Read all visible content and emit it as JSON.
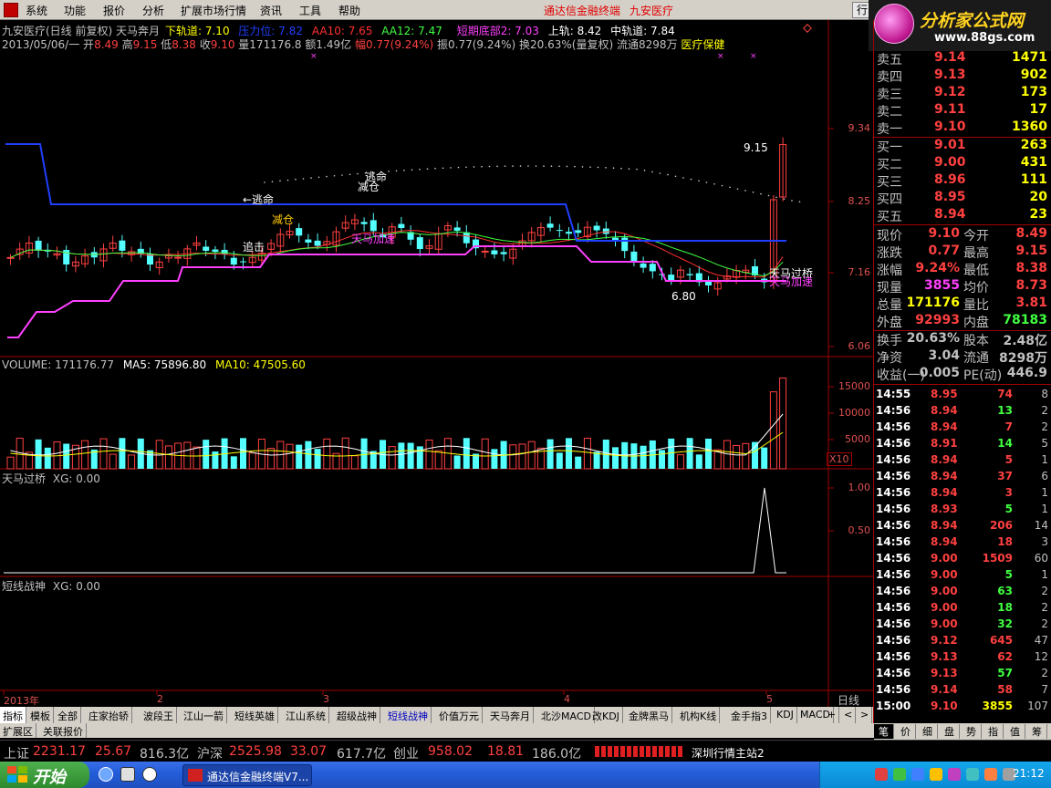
{
  "menu": [
    "系统",
    "功能",
    "报价",
    "分析",
    "扩展市场行情",
    "资讯",
    "工具",
    "帮助"
  ],
  "menu_title": [
    "通达信金融终端",
    "九安医疗"
  ],
  "hq_button": "行",
  "logo": {
    "main": "分析家公式网",
    "url": "www.88gs.com"
  },
  "header": {
    "title_line": "九安医疗(日线 前复权) 天马奔月",
    "indicators": [
      {
        "label": "下轨道: 7.10",
        "color": "#ffff00"
      },
      {
        "label": "压力位: 7.82",
        "color": "#2040ff"
      },
      {
        "label": "AA10: 7.65",
        "color": "#ff3030"
      },
      {
        "label": "AA12: 7.47",
        "color": "#40ff40"
      },
      {
        "label": "短期底部2: 7.03",
        "color": "#ff40ff"
      },
      {
        "label": "上轨: 8.42",
        "color": "#ffffff"
      },
      {
        "label": "中轨道: 7.84",
        "color": "#ffffff"
      }
    ],
    "date": "2013/05/06/一",
    "ohlc": [
      {
        "k": "开",
        "v": "8.49"
      },
      {
        "k": "高",
        "v": "9.15"
      },
      {
        "k": "低",
        "v": "8.38"
      },
      {
        "k": "收",
        "v": "9.10"
      }
    ],
    "vol": "量171176.8",
    "amt": "额1.49亿",
    "chg": "幅0.77(9.24%)",
    "amp": "振0.77(9.24%)",
    "turn": "换20.63%(量复权)",
    "float": "流通8298万",
    "sector": "医疗保健"
  },
  "price_axis": [
    "9.34",
    "8.25",
    "7.16",
    "6.06"
  ],
  "annotations": [
    {
      "text": "9.15",
      "color": "#ffffff"
    },
    {
      "text": "6.80",
      "color": "#ffffff"
    },
    {
      "text": "←逃命",
      "color": "#ffffff"
    },
    {
      "text": "逃命",
      "color": "#ffffff"
    },
    {
      "text": "减仓",
      "color": "#ffffff"
    },
    {
      "text": "减仓",
      "color": "#ffcc00"
    },
    {
      "text": "追击",
      "color": "#ffffff"
    },
    {
      "text": "天马加速",
      "color": "#ff40ff"
    },
    {
      "text": "天马过桥",
      "color": "#ffffff"
    },
    {
      "text": "天马加速",
      "color": "#ff40ff"
    }
  ],
  "volume": {
    "title": "VOLUME: 171176.77",
    "ma5": "MA5: 75896.80",
    "ma10": "MA10: 47505.60",
    "axis": [
      "15000",
      "10000",
      "5000"
    ],
    "unit": "X10"
  },
  "panel3": {
    "title": "天马过桥",
    "xg": "XG: 0.00",
    "axis": [
      "1.00",
      "0.50"
    ]
  },
  "panel4": {
    "title": "短线战神",
    "xg": "XG: 0.00"
  },
  "date_axis": [
    "2013年",
    "2",
    "3",
    "4",
    "5"
  ],
  "period": "日线",
  "tabs": [
    "指标",
    "模板",
    "全部",
    "庄家抬轿",
    "波段王",
    "江山一箭",
    "短线英雄",
    "江山系统",
    "超级战神",
    "短线战神",
    "价值万元",
    "天马奔月",
    "北沙MACD",
    "改KDJ",
    "金牌黑马",
    "机构K线",
    "金手指3",
    "KDJ",
    "MACD"
  ],
  "tab_icons": [
    "+",
    "<",
    ">"
  ],
  "tabs2": [
    "扩展区",
    "关联报价"
  ],
  "quote": {
    "sell": [
      {
        "k": "卖五",
        "p": "9.14",
        "v": "1471"
      },
      {
        "k": "卖四",
        "p": "9.13",
        "v": "902"
      },
      {
        "k": "卖三",
        "p": "9.12",
        "v": "173"
      },
      {
        "k": "卖二",
        "p": "9.11",
        "v": "17"
      },
      {
        "k": "卖一",
        "p": "9.10",
        "v": "1360"
      }
    ],
    "buy": [
      {
        "k": "买一",
        "p": "9.01",
        "v": "263"
      },
      {
        "k": "买二",
        "p": "9.00",
        "v": "431"
      },
      {
        "k": "买三",
        "p": "8.96",
        "v": "111"
      },
      {
        "k": "买四",
        "p": "8.95",
        "v": "20"
      },
      {
        "k": "买五",
        "p": "8.94",
        "v": "23"
      }
    ],
    "stats": [
      {
        "k1": "现价",
        "v1": "9.10",
        "k2": "今开",
        "v2": "8.49",
        "c1": "#ff4040",
        "c2": "#ff4040"
      },
      {
        "k1": "涨跌",
        "v1": "0.77",
        "k2": "最高",
        "v2": "9.15",
        "c1": "#ff4040",
        "c2": "#ff4040"
      },
      {
        "k1": "涨幅",
        "v1": "9.24%",
        "k2": "最低",
        "v2": "8.38",
        "c1": "#ff4040",
        "c2": "#ff4040"
      },
      {
        "k1": "现量",
        "v1": "3855",
        "k2": "均价",
        "v2": "8.73",
        "c1": "#ff40ff",
        "c2": "#ff4040"
      },
      {
        "k1": "总量",
        "v1": "171176",
        "k2": "量比",
        "v2": "3.81",
        "c1": "#ffff00",
        "c2": "#ff4040"
      },
      {
        "k1": "外盘",
        "v1": "92993",
        "k2": "内盘",
        "v2": "78183",
        "c1": "#ff4040",
        "c2": "#40ff40"
      }
    ],
    "stats2": [
      {
        "k1": "换手",
        "v1": "20.63%",
        "k2": "股本",
        "v2": "2.48亿"
      },
      {
        "k1": "净资",
        "v1": "3.04",
        "k2": "流通",
        "v2": "8298万"
      },
      {
        "k1": "收益(一)",
        "v1": "0.005",
        "k2": "PE(动)",
        "v2": "446.9"
      }
    ],
    "ticks": [
      {
        "t": "14:55",
        "p": "8.95",
        "v": "74",
        "n": "8",
        "c": "#ff4040"
      },
      {
        "t": "14:56",
        "p": "8.94",
        "v": "13",
        "n": "2",
        "c": "#40ff40"
      },
      {
        "t": "14:56",
        "p": "8.94",
        "v": "7",
        "n": "2",
        "c": "#ff4040"
      },
      {
        "t": "14:56",
        "p": "8.91",
        "v": "14",
        "n": "5",
        "c": "#40ff40"
      },
      {
        "t": "14:56",
        "p": "8.94",
        "v": "5",
        "n": "1",
        "c": "#ff4040"
      },
      {
        "t": "14:56",
        "p": "8.94",
        "v": "37",
        "n": "6",
        "c": "#ff4040"
      },
      {
        "t": "14:56",
        "p": "8.94",
        "v": "3",
        "n": "1",
        "c": "#ff4040"
      },
      {
        "t": "14:56",
        "p": "8.93",
        "v": "5",
        "n": "1",
        "c": "#40ff40"
      },
      {
        "t": "14:56",
        "p": "8.94",
        "v": "206",
        "n": "14",
        "c": "#ff4040"
      },
      {
        "t": "14:56",
        "p": "8.94",
        "v": "18",
        "n": "3",
        "c": "#ff4040"
      },
      {
        "t": "14:56",
        "p": "9.00",
        "v": "1509",
        "n": "60",
        "c": "#ff4040"
      },
      {
        "t": "14:56",
        "p": "9.00",
        "v": "5",
        "n": "1",
        "c": "#40ff40"
      },
      {
        "t": "14:56",
        "p": "9.00",
        "v": "63",
        "n": "2",
        "c": "#40ff40"
      },
      {
        "t": "14:56",
        "p": "9.00",
        "v": "18",
        "n": "2",
        "c": "#40ff40"
      },
      {
        "t": "14:56",
        "p": "9.00",
        "v": "32",
        "n": "2",
        "c": "#40ff40"
      },
      {
        "t": "14:56",
        "p": "9.12",
        "v": "645",
        "n": "47",
        "c": "#ff4040"
      },
      {
        "t": "14:56",
        "p": "9.13",
        "v": "62",
        "n": "12",
        "c": "#ff4040"
      },
      {
        "t": "14:56",
        "p": "9.13",
        "v": "57",
        "n": "2",
        "c": "#40ff40"
      },
      {
        "t": "14:56",
        "p": "9.14",
        "v": "58",
        "n": "7",
        "c": "#ff4040"
      },
      {
        "t": "15:00",
        "p": "9.10",
        "v": "3855",
        "n": "107",
        "c": "#ffff00"
      }
    ]
  },
  "rtabs": [
    "笔",
    "价",
    "细",
    "盘",
    "势",
    "指",
    "值",
    "筹"
  ],
  "status": [
    {
      "k": "上证",
      "v": "2231.17",
      "c": "25.67",
      "a": "816.3亿"
    },
    {
      "k": "沪深",
      "v": "2525.98",
      "c": "33.07",
      "a": "617.7亿"
    },
    {
      "k": "创业",
      "v": "958.02",
      "c": "18.81",
      "a": "186.0亿"
    }
  ],
  "station": "深圳行情主站2",
  "taskbar": {
    "start": "开始",
    "item": "通达信金融终端V7...",
    "clock": "21:12"
  },
  "colors": {
    "up": "#ff4040",
    "down": "#54ffff",
    "ma5": "#ff3030",
    "ma10": "#40ff40",
    "blue": "#2040ff",
    "magenta": "#ff40ff",
    "grid": "#a00000"
  }
}
